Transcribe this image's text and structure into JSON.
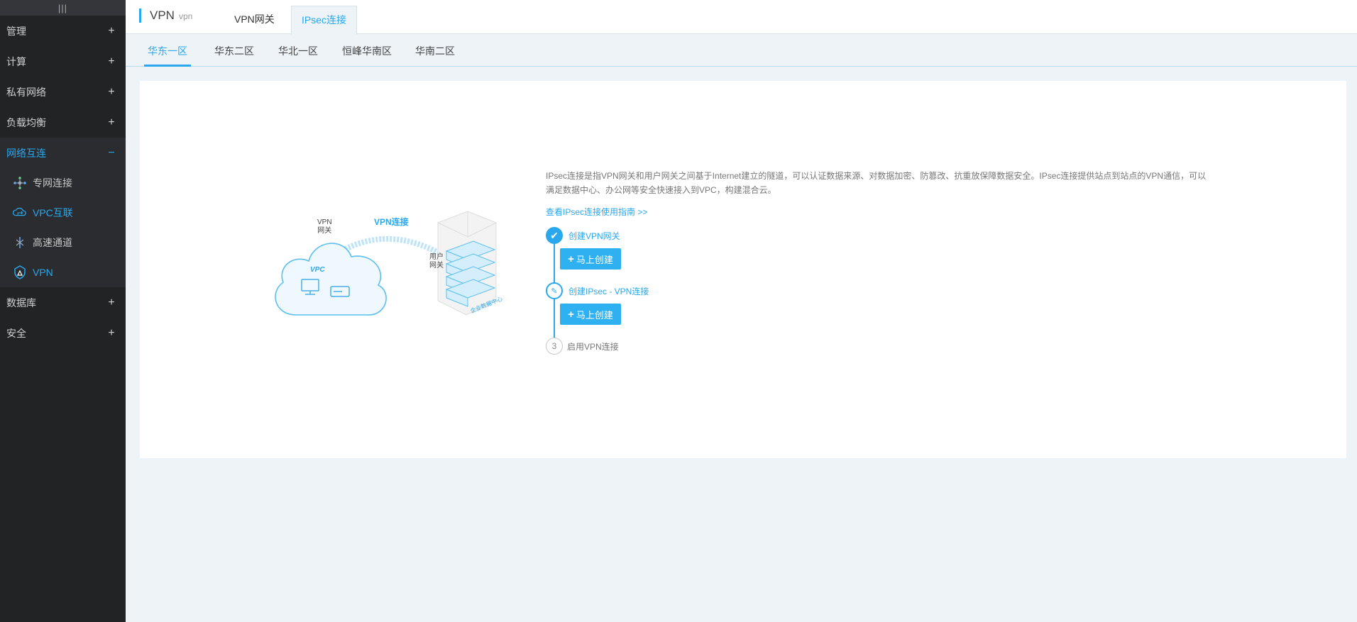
{
  "sidebar": {
    "toggle": "|||",
    "items": [
      {
        "label": "管理",
        "sign": "+"
      },
      {
        "label": "计算",
        "sign": "+"
      },
      {
        "label": "私有网络",
        "sign": "+"
      },
      {
        "label": "负载均衡",
        "sign": "+"
      }
    ],
    "active_group": {
      "label": "网络互连",
      "sign": "−"
    },
    "sub_items": [
      {
        "label": "专网连接",
        "icon": "network-nodes-icon"
      },
      {
        "label": "VPC互联",
        "icon": "vpc-peering-icon"
      },
      {
        "label": "高速通道",
        "icon": "express-channel-icon"
      },
      {
        "label": "VPN",
        "icon": "vpn-shield-icon"
      }
    ],
    "bottom_items": [
      {
        "label": "数据库",
        "sign": "+"
      },
      {
        "label": "安全",
        "sign": "+"
      }
    ]
  },
  "header": {
    "title": "VPN",
    "subtitle": "vpn",
    "tabs": [
      "VPN网关",
      "IPsec连接"
    ]
  },
  "regions": [
    "华东一区",
    "华东二区",
    "华北一区",
    "恒峰华南区",
    "华南二区"
  ],
  "illustration": {
    "vpn_gateway_line1": "VPN",
    "vpn_gateway_line2": "网关",
    "vpn_connection": "VPN连接",
    "vpc": "VPC",
    "user_gateway_line1": "用户",
    "user_gateway_line2": "网关",
    "datacenter": "企业数据中心"
  },
  "info": {
    "description": "IPsec连接是指VPN网关和用户网关之间基于Internet建立的隧道，可以认证数据来源、对数据加密、防篡改、抗重放保障数据安全。IPsec连接提供站点到站点的VPN通信，可以满足数据中心、办公网等安全快速接入到VPC，构建混合云。",
    "guide_link": "查看IPsec连接使用指南 >>",
    "steps": [
      {
        "label": "创建VPN网关",
        "button": "马上创建"
      },
      {
        "label": "创建IPsec - VPN连接",
        "button": "马上创建"
      },
      {
        "number": "3",
        "label": "启用VPN连接"
      }
    ]
  },
  "colors": {
    "accent": "#29a8ee",
    "sidebar_bg": "#222325",
    "page_bg": "#edf3f7"
  }
}
